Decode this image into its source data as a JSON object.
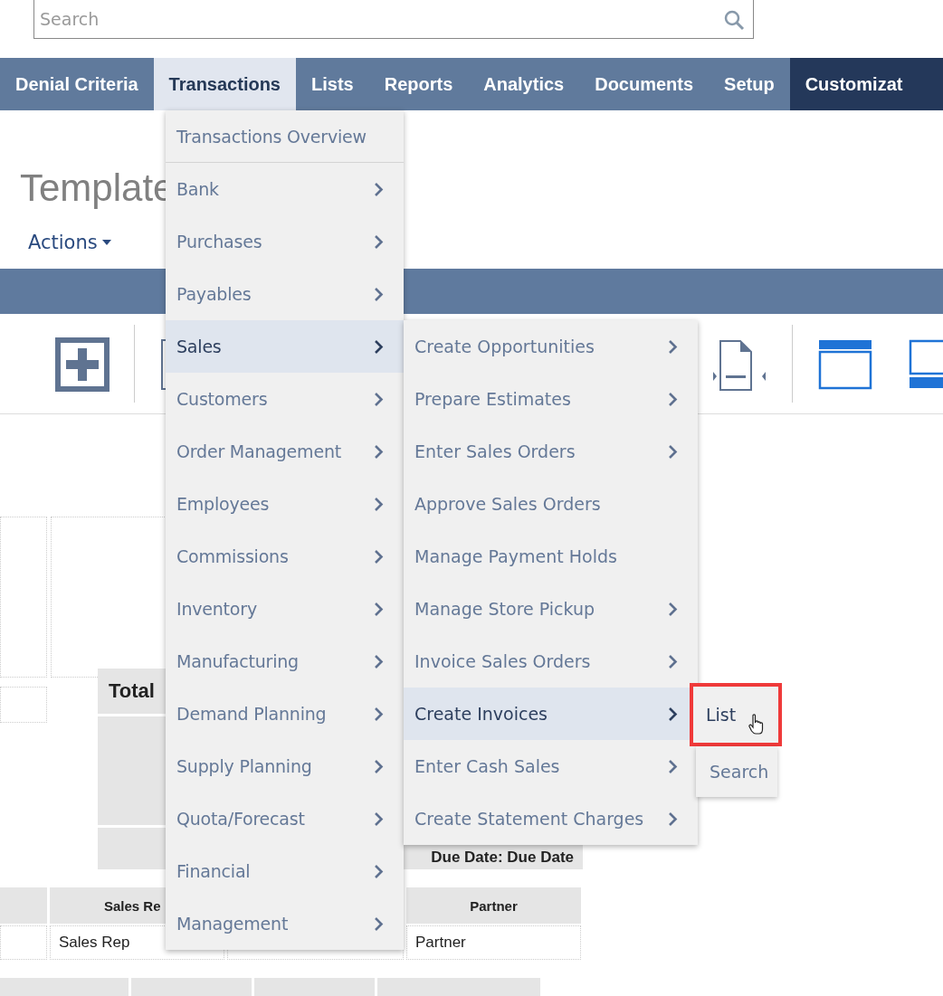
{
  "search": {
    "placeholder": "Search"
  },
  "nav": [
    {
      "label": "Denial Criteria",
      "kind": "normal",
      "selected": false
    },
    {
      "label": "Transactions",
      "kind": "normal",
      "selected": true
    },
    {
      "label": "Lists",
      "kind": "normal",
      "selected": false
    },
    {
      "label": "Reports",
      "kind": "normal",
      "selected": false
    },
    {
      "label": "Analytics",
      "kind": "normal",
      "selected": false
    },
    {
      "label": "Documents",
      "kind": "normal",
      "selected": false
    },
    {
      "label": "Setup",
      "kind": "normal",
      "selected": false
    },
    {
      "label": "Customizat",
      "kind": "accent",
      "selected": false
    }
  ],
  "page": {
    "title": "Template",
    "actions": "Actions"
  },
  "form": {
    "total": "Total",
    "due_date": "Due Date: Due Date",
    "headers": [
      "Sales Re",
      "Partner"
    ],
    "cells": [
      "Sales Rep",
      "Partner"
    ]
  },
  "menu": [
    {
      "label": "Transactions Overview",
      "has_submenu": false,
      "selected": false
    },
    {
      "label": "Bank",
      "has_submenu": true,
      "selected": false
    },
    {
      "label": "Purchases",
      "has_submenu": true,
      "selected": false
    },
    {
      "label": "Payables",
      "has_submenu": true,
      "selected": false
    },
    {
      "label": "Sales",
      "has_submenu": true,
      "selected": true
    },
    {
      "label": "Customers",
      "has_submenu": true,
      "selected": false
    },
    {
      "label": "Order Management",
      "has_submenu": true,
      "selected": false
    },
    {
      "label": "Employees",
      "has_submenu": true,
      "selected": false
    },
    {
      "label": "Commissions",
      "has_submenu": true,
      "selected": false
    },
    {
      "label": "Inventory",
      "has_submenu": true,
      "selected": false
    },
    {
      "label": "Manufacturing",
      "has_submenu": true,
      "selected": false
    },
    {
      "label": "Demand Planning",
      "has_submenu": true,
      "selected": false
    },
    {
      "label": "Supply Planning",
      "has_submenu": true,
      "selected": false
    },
    {
      "label": "Quota/Forecast",
      "has_submenu": true,
      "selected": false
    },
    {
      "label": "Financial",
      "has_submenu": true,
      "selected": false
    },
    {
      "label": "Management",
      "has_submenu": true,
      "selected": false
    }
  ],
  "submenu": [
    {
      "label": "Create Opportunities",
      "has_submenu": true,
      "selected": false
    },
    {
      "label": "Prepare Estimates",
      "has_submenu": true,
      "selected": false
    },
    {
      "label": "Enter Sales Orders",
      "has_submenu": true,
      "selected": false
    },
    {
      "label": "Approve Sales Orders",
      "has_submenu": false,
      "selected": false
    },
    {
      "label": "Manage Payment Holds",
      "has_submenu": false,
      "selected": false
    },
    {
      "label": "Manage Store Pickup",
      "has_submenu": true,
      "selected": false
    },
    {
      "label": "Invoice Sales Orders",
      "has_submenu": true,
      "selected": false
    },
    {
      "label": "Create Invoices",
      "has_submenu": true,
      "selected": true
    },
    {
      "label": "Enter Cash Sales",
      "has_submenu": true,
      "selected": false
    },
    {
      "label": "Create Statement Charges",
      "has_submenu": true,
      "selected": false
    }
  ],
  "submenu_2": [
    {
      "label": "List",
      "highlighted": true
    },
    {
      "label": "Search",
      "highlighted": false
    }
  ]
}
